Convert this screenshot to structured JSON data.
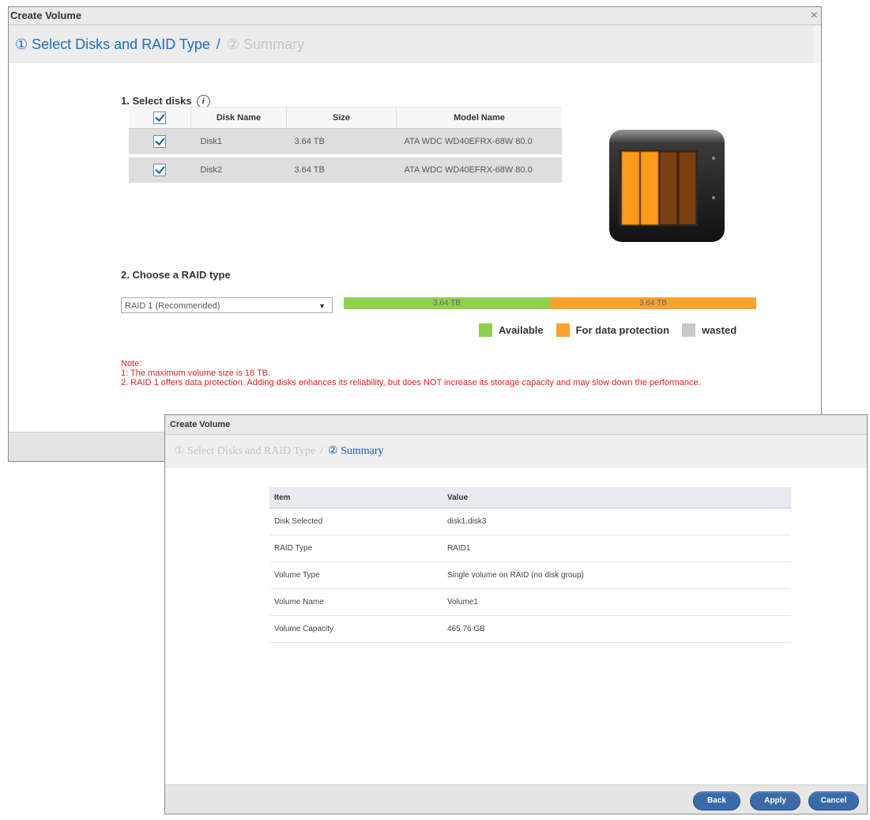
{
  "dialog1": {
    "title": "Create Volume",
    "close": "×",
    "steps": {
      "step1": "① Select Disks and RAID Type",
      "separator": "/",
      "step2": "② Summary"
    },
    "select_disks": {
      "title": "1. Select disks",
      "info": "i",
      "columns": [
        "Disk Name",
        "Size",
        "Model Name"
      ],
      "rows": [
        {
          "name": "Disk1",
          "size": "3.64 TB",
          "model": "ATA WDC WD40EFRX-68W 80.0"
        },
        {
          "name": "Disk2",
          "size": "3.64 TB",
          "model": "ATA WDC WD40EFRX-68W 80.0"
        }
      ]
    },
    "raid": {
      "title": "2. Choose a RAID type",
      "selected": "RAID 1 (Recommended)",
      "bar": [
        {
          "label": "3.64 TB",
          "color": "#8fd14f",
          "fraction": 0.5
        },
        {
          "label": "3.64 TB",
          "color": "#f7a233",
          "fraction": 0.5
        }
      ],
      "legend": [
        {
          "label": "Available",
          "color": "#8fd14f"
        },
        {
          "label": "For data protection",
          "color": "#f7a233"
        },
        {
          "label": "wasted",
          "color": "#c9c9c9"
        }
      ]
    },
    "note": {
      "title": "Note:",
      "line1": "1: The maximum volume size is 18 TB.",
      "line2": "2. RAID 1 offers data protection. Adding disks enhances its reliability, but does NOT increase its storage capacity and may slow down the performance."
    }
  },
  "dialog2": {
    "title": "Create Volume",
    "steps": {
      "step1": "① Select Disks and RAID Type",
      "separator": "/",
      "step2": "② Summary"
    },
    "table": {
      "columns": [
        "Item",
        "Value"
      ],
      "rows": [
        {
          "item": "Disk Selected",
          "value": "disk1,disk3"
        },
        {
          "item": "RAID Type",
          "value": "RAID1"
        },
        {
          "item": "Volume Type",
          "value": "Single volume on RAID (no disk group)"
        },
        {
          "item": "Volume Name",
          "value": "Volume1"
        },
        {
          "item": "Volume Capacity",
          "value": "465.76 GB"
        }
      ]
    },
    "buttons": {
      "back": "Back",
      "apply": "Apply",
      "cancel": "Cancel"
    }
  }
}
